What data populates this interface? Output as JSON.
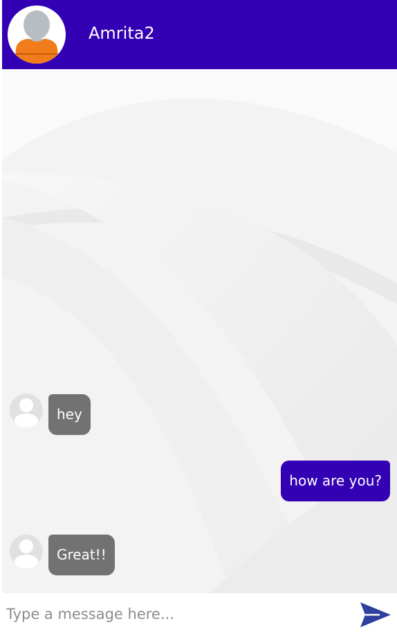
{
  "header": {
    "contact_name": "Amrita2",
    "avatar_icon": "user-avatar-icon"
  },
  "messages": [
    {
      "direction": "incoming",
      "text": "hey"
    },
    {
      "direction": "outgoing",
      "text": "how are you?"
    },
    {
      "direction": "incoming",
      "text": "Great!!"
    }
  ],
  "composer": {
    "placeholder": "Type a message here...",
    "value": "",
    "send_icon": "send-icon"
  },
  "colors": {
    "primary": "#3300b4",
    "incoming_bubble": "#727272",
    "avatar_shirt": "#f07c1a"
  }
}
